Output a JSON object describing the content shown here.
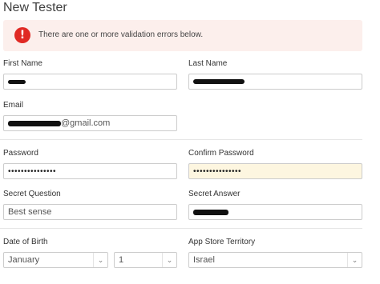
{
  "page": {
    "title": "New Tester"
  },
  "alert": {
    "icon": "!",
    "icon_name": "error-icon",
    "message": "There are one or more validation errors below.",
    "accent": "#e02a24",
    "background": "#fcefec"
  },
  "form": {
    "first_name": {
      "label": "First Name",
      "value": ""
    },
    "last_name": {
      "label": "Last Name",
      "value": ""
    },
    "email": {
      "label": "Email",
      "value_suffix": "@gmail.com"
    },
    "password": {
      "label": "Password",
      "value": "•••••••••••••••"
    },
    "confirm_password": {
      "label": "Confirm Password",
      "value": "•••••••••••••••"
    },
    "secret_question": {
      "label": "Secret Question",
      "value": "Best sense"
    },
    "secret_answer": {
      "label": "Secret Answer",
      "value": ""
    },
    "date_of_birth": {
      "label": "Date of Birth",
      "month": "January",
      "day": "1"
    },
    "app_store_territory": {
      "label": "App Store Territory",
      "value": "Israel"
    }
  },
  "icons": {
    "caret": "chevron-down-icon"
  }
}
